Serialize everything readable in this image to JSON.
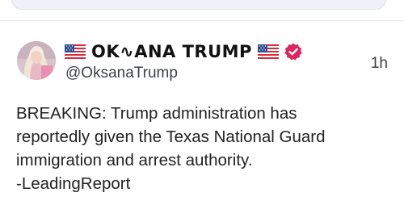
{
  "tweet": {
    "display_name": "OK∿ANA TRUMP",
    "handle": "@OksanaTrump",
    "time": "1h",
    "text_lines": [
      "BREAKING: Trump administration has",
      "reportedly given the Texas National Guard",
      "immigration and arrest authority.",
      "-LeadingReport"
    ],
    "icons": {
      "flag_left": "us-flag-icon",
      "flag_right": "us-flag-icon",
      "verified": "verified-badge-icon"
    }
  },
  "colors": {
    "verified_badge": "#e0245e",
    "secondary_text": "#3b3f45",
    "search_pill": "#eef1f8"
  }
}
